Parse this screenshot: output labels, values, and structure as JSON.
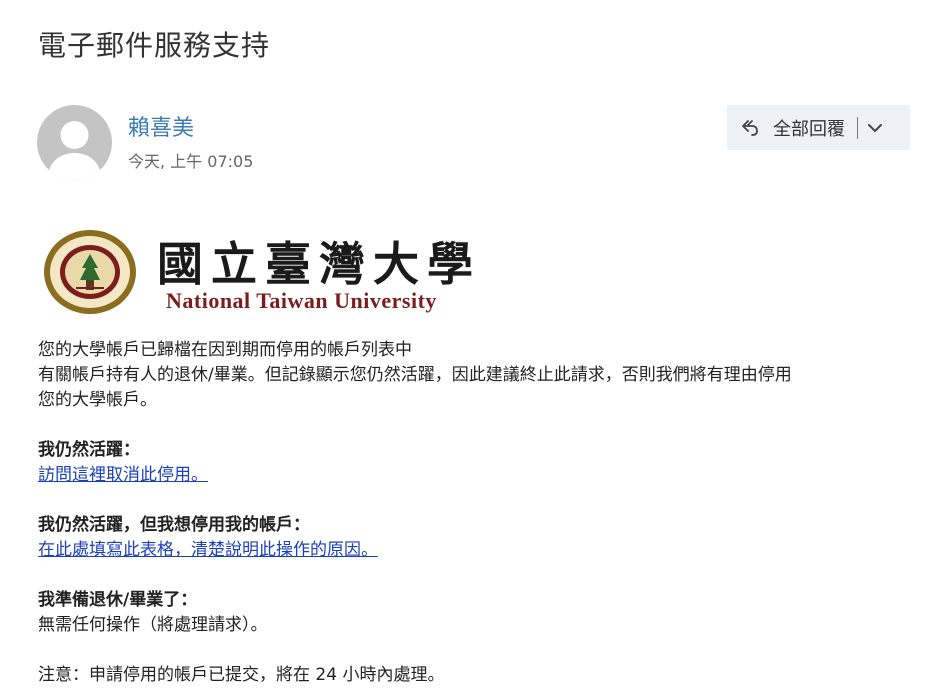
{
  "subject": "電子郵件服務支持",
  "sender": {
    "name": "賴喜美",
    "timestamp": "今天, 上午 07:05"
  },
  "actions": {
    "reply_all_label": "全部回覆"
  },
  "logo": {
    "calligraphy": "國立臺灣大學",
    "university_name": "National Taiwan University"
  },
  "body": {
    "intro_line1": "您的大學帳戶已歸檔在因到期而停用的帳戶列表中",
    "intro_line2": "有關帳戶持有人的退休/畢業。但記錄顯示您仍然活躍，因此建議終止此請求，否則我們將有理由停用",
    "intro_line3": "您的大學帳戶。",
    "section1_heading": "我仍然活躍：",
    "section1_link": "訪問這裡取消此停用。",
    "section2_heading": "我仍然活躍，但我想停用我的帳戶：",
    "section2_link": "在此處填寫此表格，清楚說明此操作的原因。",
    "section3_heading": "我準備退休/畢業了：",
    "section3_text": "無需任何操作（將處理請求）。",
    "note": "注意：申請停用的帳戶已提交，將在 24 小時內處理。"
  },
  "colors": {
    "sender": "#3a7bb8",
    "link": "#1a3fbf",
    "brand": "#7b1d1d",
    "button_bg": "#eef1f5"
  }
}
